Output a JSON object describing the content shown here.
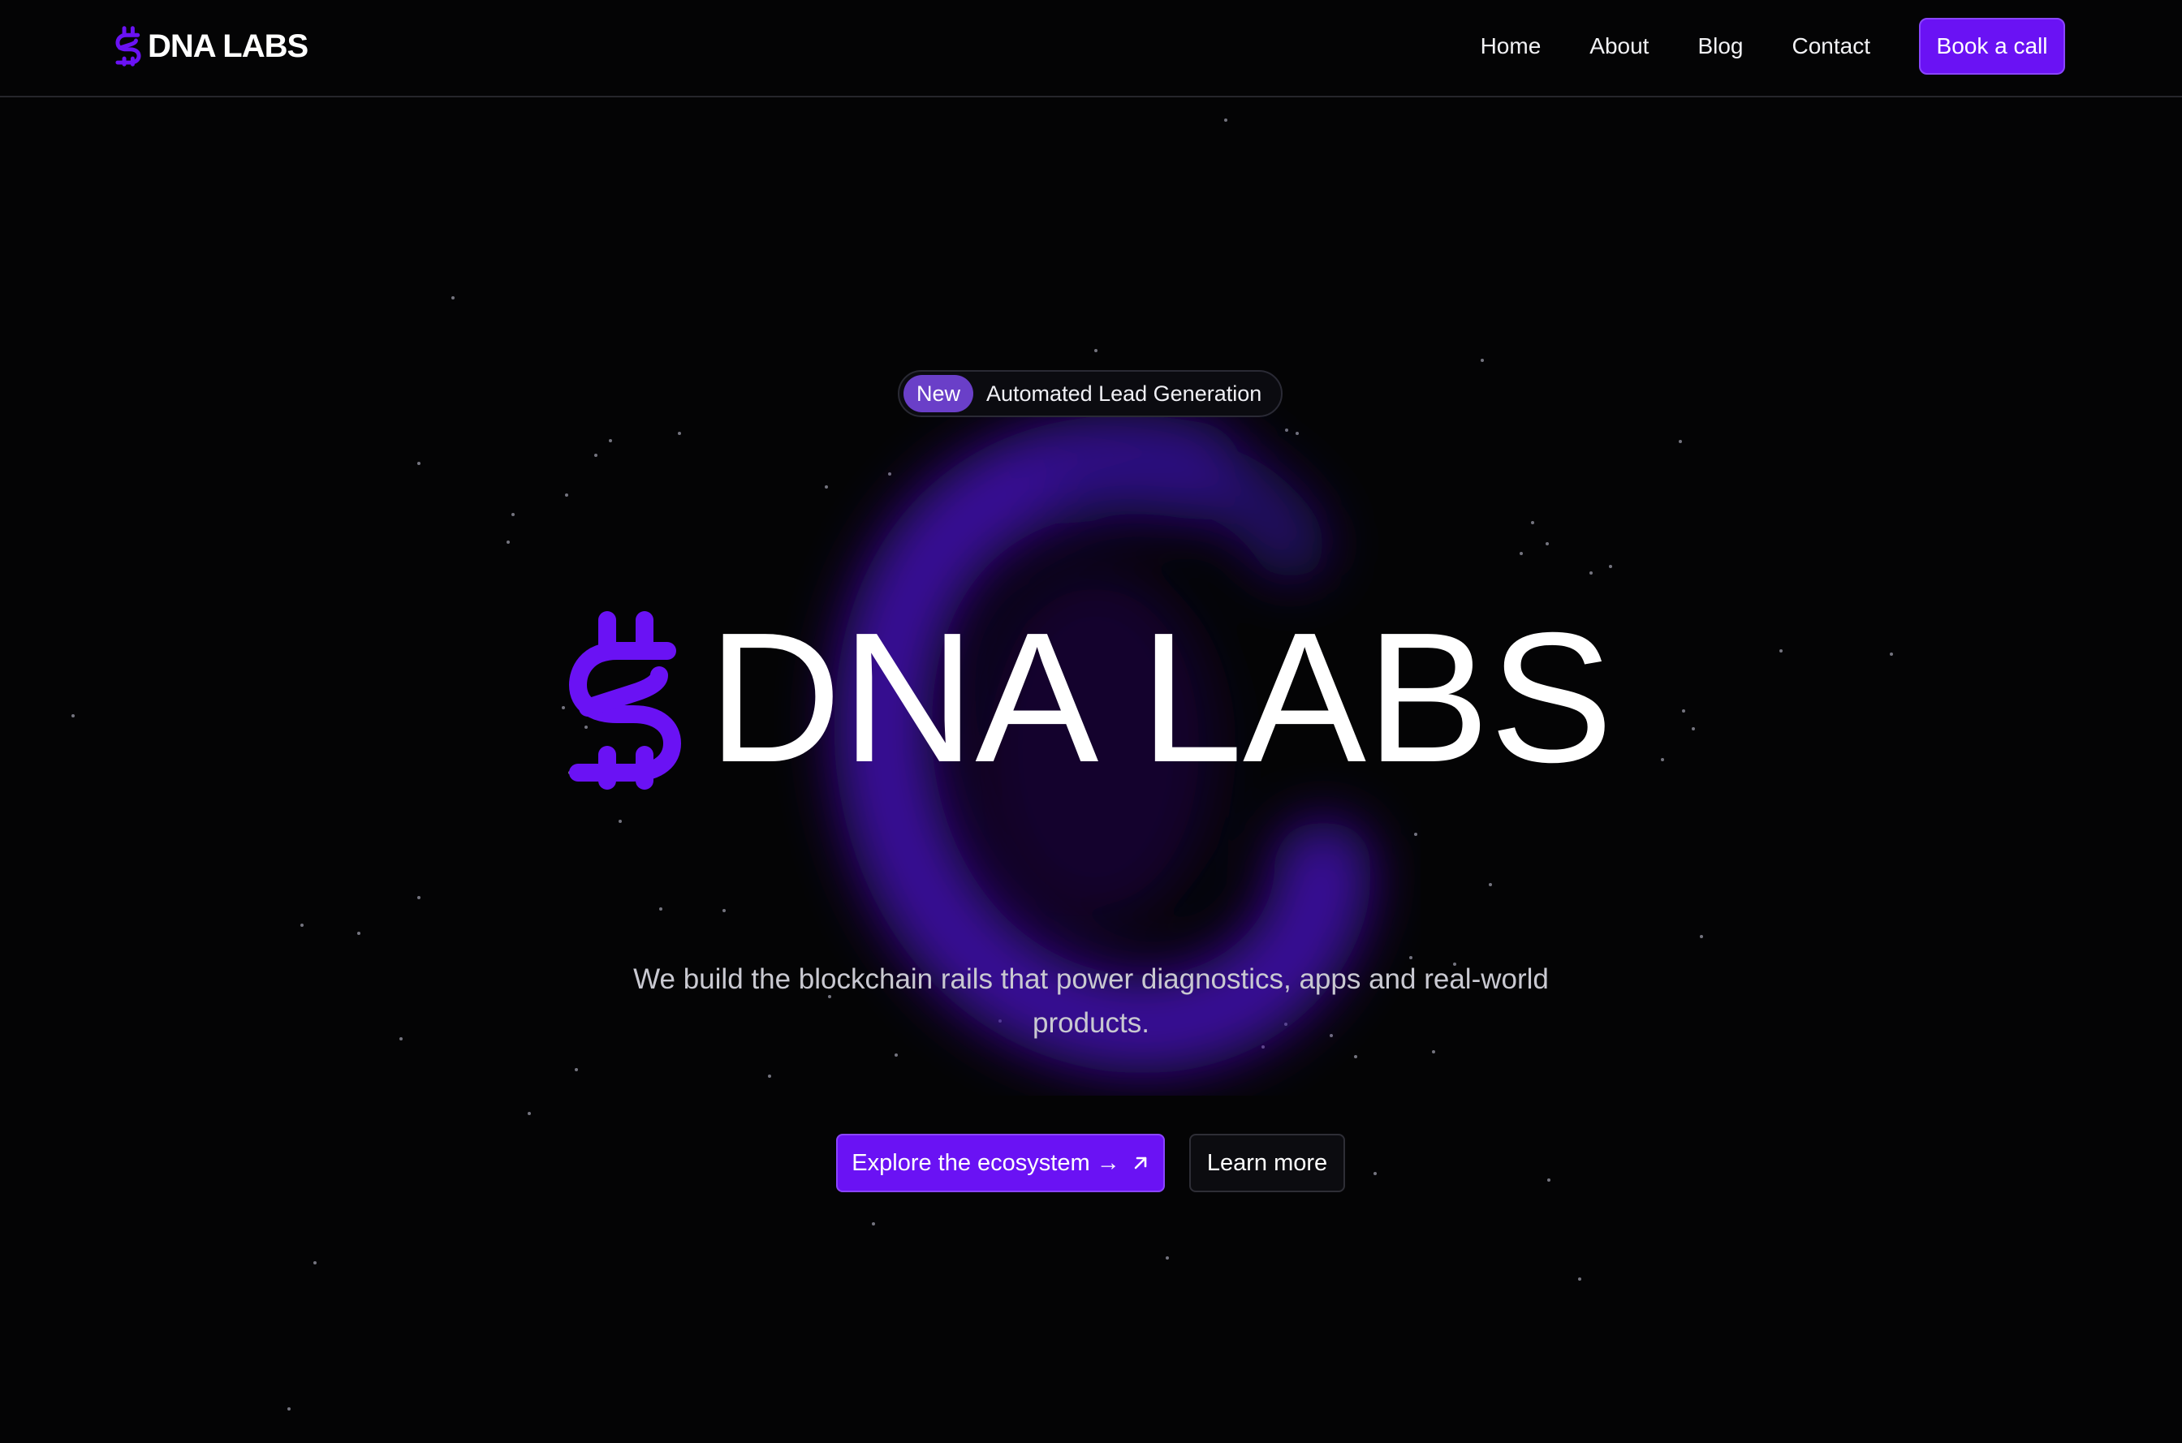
{
  "brand": {
    "name": "DNA LABS",
    "icon": "dollar-dna-icon",
    "accent": "#6a12f4"
  },
  "nav": {
    "links": [
      "Home",
      "About",
      "Blog",
      "Contact"
    ],
    "cta_label": "Book a call"
  },
  "hero": {
    "badge": {
      "pill": "New",
      "text": "Automated Lead Generation"
    },
    "title": "DNA LABS",
    "subtitle": "We build the blockchain rails that power diagnostics, apps and real-world products.",
    "primary_button": {
      "label": "Explore the ecosystem →",
      "icon": "external-arrow-icon"
    },
    "secondary_button": {
      "label": "Learn more"
    }
  },
  "colors": {
    "background": "#040405",
    "primary": "#6a12f4",
    "glow": "#3c0fa0"
  }
}
